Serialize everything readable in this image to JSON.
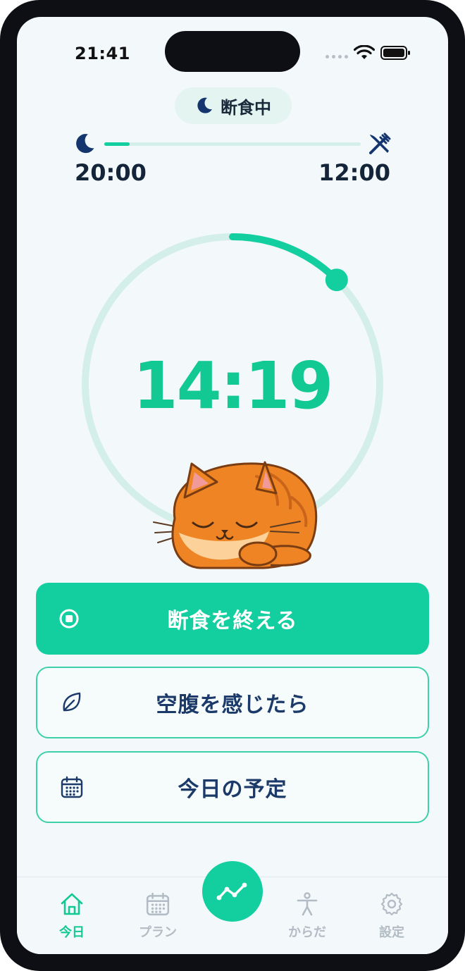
{
  "status_bar": {
    "time": "21:41",
    "icons": [
      "signal-icon",
      "wifi-icon",
      "battery-icon"
    ]
  },
  "fasting": {
    "state_label": "断食中",
    "state_icon": "moon-icon",
    "schedule": {
      "start_time": "20:00",
      "end_time": "12:00",
      "start_icon": "moon-icon",
      "end_icon": "fork-knife-icon",
      "progress": 0.1
    },
    "elapsed_time": "14:19",
    "ring_progress": 0.125,
    "mascot": "sleeping-cat"
  },
  "actions": {
    "end_fast": {
      "label": "断食を終える",
      "icon": "stop-icon"
    },
    "hunger": {
      "label": "空腹を感じたら",
      "icon": "leaf-icon"
    },
    "today_plan": {
      "label": "今日の予定",
      "icon": "calendar-icon"
    }
  },
  "tabs": [
    {
      "label": "今日",
      "icon": "home-icon",
      "active": true
    },
    {
      "label": "プラン",
      "icon": "calendar-icon",
      "active": false
    },
    {
      "label": "からだ",
      "icon": "body-icon",
      "active": false
    },
    {
      "label": "設定",
      "icon": "gear-icon",
      "active": false
    }
  ],
  "center_action": {
    "icon": "chart-line-icon"
  },
  "colors": {
    "accent": "#13cfa0",
    "text_dark": "#14253a",
    "label_blue": "#1b3a6a",
    "inactive": "#b3bcc4",
    "track": "#d4efe9"
  }
}
